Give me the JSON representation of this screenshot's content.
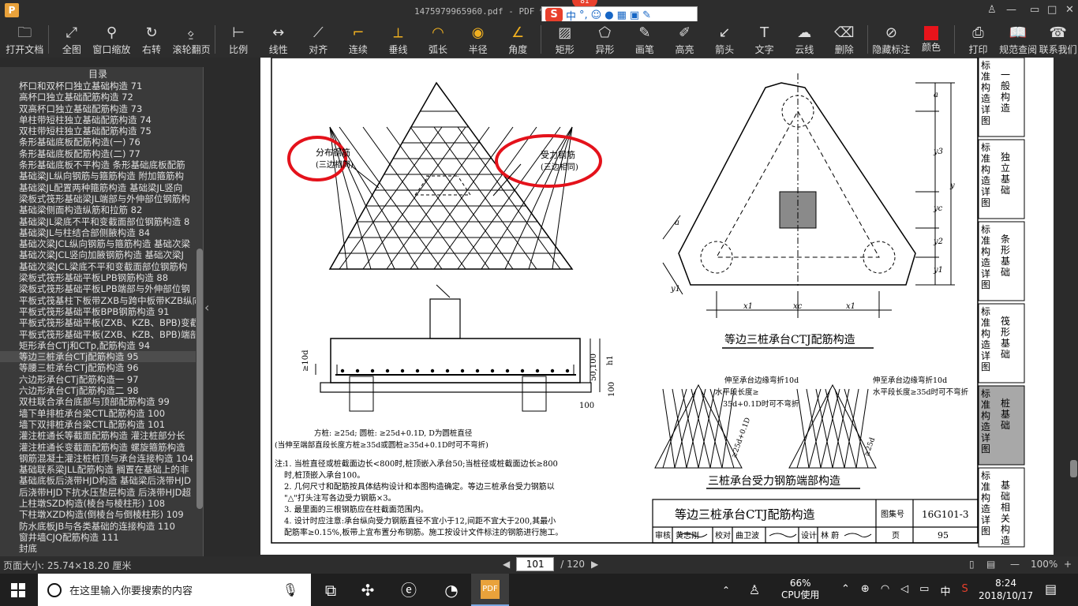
{
  "window": {
    "title": "1475979965960.pdf - PDF 快",
    "badge": "81",
    "ime": {
      "label": "中",
      "items": [
        "中",
        "°,",
        "☺",
        "🎤",
        "⌨",
        "👕",
        "🔧"
      ]
    }
  },
  "toolbar": [
    {
      "label": "打开文档",
      "icon": "folder-icon"
    },
    {
      "label": "全图",
      "icon": "fit-page-icon"
    },
    {
      "label": "窗口缩放",
      "icon": "zoom-icon"
    },
    {
      "label": "右转",
      "icon": "rotate-icon"
    },
    {
      "label": "滚轮翻页",
      "icon": "mouse-icon"
    },
    {
      "label": "比例",
      "icon": "scale-icon"
    },
    {
      "label": "线性",
      "icon": "linear-icon"
    },
    {
      "label": "对齐",
      "icon": "align-icon"
    },
    {
      "label": "连续",
      "icon": "continuous-icon"
    },
    {
      "label": "垂线",
      "icon": "perpendicular-icon"
    },
    {
      "label": "弧长",
      "icon": "arc-icon"
    },
    {
      "label": "半径",
      "icon": "radius-icon"
    },
    {
      "label": "角度",
      "icon": "angle-icon"
    },
    {
      "label": "矩形",
      "icon": "rectangle-icon"
    },
    {
      "label": "异形",
      "icon": "polygon-icon"
    },
    {
      "label": "画笔",
      "icon": "pen-icon"
    },
    {
      "label": "高亮",
      "icon": "highlight-icon"
    },
    {
      "label": "箭头",
      "icon": "arrow-icon"
    },
    {
      "label": "文字",
      "icon": "text-icon"
    },
    {
      "label": "云线",
      "icon": "cloud-icon"
    },
    {
      "label": "删除",
      "icon": "eraser-icon"
    },
    {
      "label": "隐藏标注",
      "icon": "hide-icon"
    },
    {
      "label": "颜色",
      "icon": "color-icon",
      "color": "#e8141b"
    },
    {
      "label": "打印",
      "icon": "print-icon"
    },
    {
      "label": "规范查阅",
      "icon": "book-icon"
    },
    {
      "label": "联系我们",
      "icon": "contact-icon"
    }
  ],
  "sidebar": {
    "title": "目录",
    "items": [
      "杯口和双杯口独立基础构造 71",
      "高杯口独立基础配筋构造 72",
      "双高杯口独立基础配筋构造 73",
      "单柱带短柱独立基础配筋构造 74",
      "双柱带短柱独立基础配筋构造 75",
      "条形基础底板配筋构造(一) 76",
      "条形基础底板配筋构造(二) 77",
      "条形基础底板不平构造 条形基础底板配筋",
      "基础梁JL纵向钢筋与箍筋构造 附加箍筋构",
      "基础梁JL配置两种箍筋构造 基础梁JL竖向",
      "梁板式筏形基础梁JL端部与外伸部位钢筋构",
      "基础梁侧面构造纵筋和拉筋 82",
      "基础梁JL梁底不平和变截面部位钢筋构造 8",
      "基础梁JL与柱结合部侧腋构造 84",
      "基础次梁JCL纵向钢筋与箍筋构造 基础次梁",
      "基础次梁JCL竖向加腋钢筋构造 基础次梁J",
      "基础次梁JCL梁底不平和变截面部位钢筋构",
      "梁板式筏形基础平板LPB钢筋构造 88",
      "梁板式筏形基础平板LPB端部与外伸部位钢",
      "平板式筏基柱下板带ZXB与跨中板带KZB纵向",
      "平板式筏形基础平板BPB钢筋构造 91",
      "平板式筏形基础平板(ZXB、KZB、BPB)变截",
      "平板式筏形基础平板(ZXB、KZB、BPB)端部",
      "矩形承台CTj和CTp,配筋构造 94",
      "等边三桩承台CTj配筋构造 95",
      "等腰三桩承台CTj配筋构造 96",
      "六边形承台CTj配筋构造一 97",
      "六边形承台CTj配筋构造二 98",
      "双柱联合承台底部与顶部配筋构造 99",
      "墙下单排桩承台梁CTL配筋构造 100",
      "墙下双排桩承台梁CTL配筋构造 101",
      "灌注桩通长等截面配筋构造 灌注桩部分长",
      "灌注桩通长变截面配筋构造 螺旋箍筋构造",
      "钢筋混凝土灌注桩桩顶与承台连接构造 104",
      "基础联系梁JLL配筋构造 搁置在基础上的非",
      "基础底板后浇带HJD构造 基础梁后浇带HJD",
      "后浇带HJD下抗水压垫层构造 后浇带HJD超",
      "上柱墩SZD构造(棱台与棱柱形) 108",
      "下柱墩XZD构造(倒棱台与倒棱柱形) 109",
      "防水底板JB与各类基础的连接构造 110",
      "窗井墙CJQ配筋构造 111",
      "封底"
    ],
    "active_index": 24
  },
  "drawing": {
    "label_distribution": "分布钢筋",
    "label_distribution_sub": "(三边相同)",
    "label_main": "受力钢筋",
    "label_main_sub": "(三边相同)",
    "dim_10d": "≥10d",
    "dim_50": "50,100",
    "dim_h1": "h1",
    "dim_100a": "100",
    "dim_100b": "100",
    "section_note1": "方桩: ≥25d; 圆桩: ≥25d+0.1D, D为圆桩直径",
    "section_note2": "(当伸至端部直段长度方桩≥35d或圆桩≥35d+0.1D时可不弯折)",
    "plan_title": "等边三桩承台CTJ配筋构造",
    "plan_dims": {
      "a": "a",
      "y3": "y3",
      "y": "y",
      "yc": "yc",
      "y2": "y2",
      "y1": "y1",
      "x1a": "x1",
      "xc": "xc",
      "x1b": "x1",
      "a2": "a",
      "y1b": "y1"
    },
    "end_note_left_1": "伸至承台边缘弯折10d",
    "end_note_left_2": "水平段长度≥",
    "end_note_left_3": "35d+0.1D时可不弯折",
    "end_note_left_4": "≥25d+0.1D",
    "end_note_right_1": "伸至承台边缘弯折10d",
    "end_note_right_2": "水平段长度≥35d时可不弯折",
    "end_note_right_3": "≥25d",
    "end_title": "三桩承台受力钢筋端部构造",
    "notes_head": "注:",
    "notes": [
      "1. 当桩直径或桩截面边长<800时,桩顶嵌入承台50;当桩径或桩截面边长≥800",
      "   时,桩顶嵌入承台100。",
      "2. 几何尺寸和配筋按具体结构设计和本图构造确定。等边三桩承台受力钢筋以",
      "   \"△\"打头注写各边受力钢筋×3。",
      "3. 最里面的三根钢筋应在柱截面范围内。",
      "4. 设计时应注意:承台纵向受力钢筋直径不宜小于12,间距不宜大于200,其最小",
      "   配筋率≥0.15%,板带上宜布置分布钢筋。施工按设计文件标注的钢筋进行施工。"
    ],
    "titleblock": {
      "title": "等边三桩承台CTJ配筋构造",
      "atlas_label": "图集号",
      "atlas_no": "16G101-3",
      "review": "审核",
      "reviewer": "黄志刚",
      "check": "校对",
      "checker": "曲卫波",
      "design": "设计",
      "designer": "林 蔚",
      "page_label": "页",
      "page_no": "95"
    },
    "side_tabs": [
      {
        "a": "标准构造详图",
        "b": "一般构造"
      },
      {
        "a": "标准构造详图",
        "b": "独立基础"
      },
      {
        "a": "标准构造详图",
        "b": "条形基础"
      },
      {
        "a": "标准构造详图",
        "b": "筏形基础"
      },
      {
        "a": "标准构造详图",
        "b": "桩基础"
      },
      {
        "a": "标准构造详图",
        "b": "基础相关构造"
      }
    ]
  },
  "status": {
    "page_size": "页面大小: 25.74×18.20 厘米",
    "current_page": "101",
    "total_pages": "/ 120",
    "zoom": "100%"
  },
  "taskbar": {
    "search_placeholder": "在这里输入你要搜索的内容",
    "cpu_percent": "66%",
    "cpu_label": "CPU使用",
    "ime": "中",
    "time": "8:24",
    "date": "2018/10/17"
  }
}
